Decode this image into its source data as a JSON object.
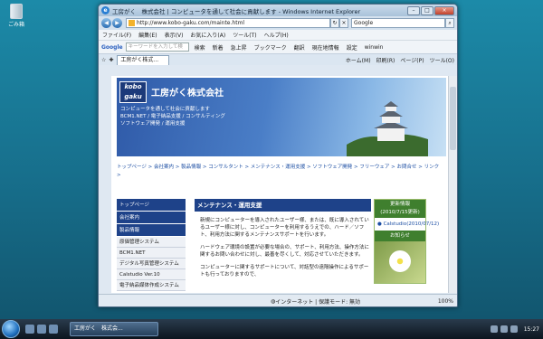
{
  "desktop": {
    "recycle_label": "ごみ箱"
  },
  "window": {
    "title": "工房がく　株式会社 | コンピュータを通して社会に貢献します - Windows Internet Explorer",
    "minimize": "–",
    "maximize": "□",
    "close": "×"
  },
  "address": {
    "url": "http://www.kobo-gaku.com/mainte.html",
    "search_engine": "Google"
  },
  "menu": [
    "ファイル(F)",
    "編集(E)",
    "表示(V)",
    "お気に入り(A)",
    "ツール(T)",
    "ヘルプ(H)"
  ],
  "google_bar": {
    "logo": "Google",
    "placeholder": "キーワードを入力して検",
    "search": "検索",
    "news": "新着",
    "top": "急上昇",
    "bookmark": "ブックマーク",
    "translate": "翻訳",
    "current_location": "現在地情報",
    "settings": "設定",
    "user": "winwin"
  },
  "tabs": {
    "active_label": "工房がく株式...",
    "home": "ホーム(M)",
    "print": "印刷(R)",
    "page": "ページ(P)",
    "tools": "ツール(O)"
  },
  "page": {
    "logo_top": "kobo",
    "logo_bottom": "gaku",
    "company_name": "工房がく株式会社",
    "tagline1": "コンピュータを通して社会に貢献します",
    "tagline2": "BCM1.NET / 電子納品支援 / コンサルティング",
    "tagline3": "ソフトウェア開発 / 運用支援",
    "breadcrumbs": "トップページ > 会社案内 > 製品情報 > コンサルタント > メンテナンス・運用支援 > ソフトウェア開発 > フリーウェア > お問合せ > リンク >",
    "sidenav": [
      {
        "label": "トップページ",
        "type": "main"
      },
      {
        "label": "会社案内",
        "type": "main"
      },
      {
        "label": "製品情報",
        "type": "main"
      },
      {
        "label": "原価管理システム",
        "type": "sub"
      },
      {
        "label": "BCM1.NET",
        "type": "sub"
      },
      {
        "label": "デジタル写真管理システム",
        "type": "sub"
      },
      {
        "label": "Calstudio Ver.10",
        "type": "sub"
      },
      {
        "label": "電子納品媒体作成システム",
        "type": "sub"
      }
    ],
    "main_heading": "メンテナンス・運用支援",
    "paragraph1": "新規にコンピューターを導入されたユーザー様、または、既に導入されているユーザー様に対し、コンピューターを利用するうえでの、ハード／ソフト、利用方法に関するメンテナンスサポートを行います。",
    "paragraph2": "ハードウェア環境の設置が必要な場合の、サポート、利用方法、操作方法に関するお問い合わせに対し、最善を尽くして、対応させていただきます。",
    "paragraph3": "コンピューターに関するサポートについて、対話型の遠隔操作によるサポートも行っておりますので、",
    "updates_heading_1": "更新情報",
    "updates_heading_2": "(2010/7/15更新)",
    "update_link": "Calstudio(2010/07/12)",
    "notice_heading": "お知らせ"
  },
  "status": {
    "zone": "インターネット | 保護モード: 無効",
    "zoom": "100%"
  },
  "taskbar": {
    "task_label": "工房がく　株式会...",
    "time": "15:27"
  }
}
